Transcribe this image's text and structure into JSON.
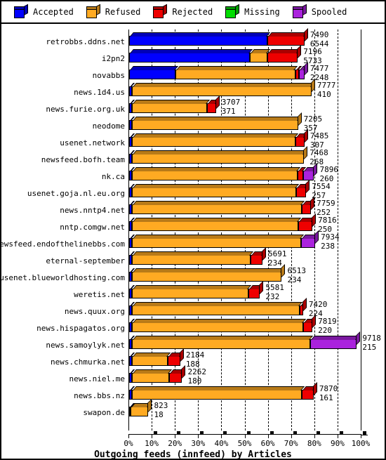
{
  "legend": {
    "items": [
      {
        "label": "Accepted",
        "color": "#0000ff",
        "icon": "cube-icon"
      },
      {
        "label": "Refused",
        "color": "#ffaa22",
        "icon": "cube-icon"
      },
      {
        "label": "Rejected",
        "color": "#ee0000",
        "icon": "cube-icon"
      },
      {
        "label": "Missing",
        "color": "#00dd00",
        "icon": "cube-icon"
      },
      {
        "label": "Spooled",
        "color": "#aa22dd",
        "icon": "cube-icon"
      }
    ]
  },
  "chart_data": {
    "type": "bar",
    "orientation": "horizontal",
    "stacked": true,
    "title": "Outgoing feeds (innfeed) by Articles",
    "xlabel": "Outgoing feeds (innfeed) by Articles",
    "ylabel": "",
    "xlim": [
      0,
      100
    ],
    "xtick_labels": [
      "0%",
      "10%",
      "20%",
      "30%",
      "40%",
      "50%",
      "60%",
      "70%",
      "80%",
      "90%",
      "100%"
    ],
    "xticks": [
      0,
      10,
      20,
      30,
      40,
      50,
      60,
      70,
      80,
      90,
      100
    ],
    "grid": "vertical-dashed",
    "legend_position": "top",
    "series_names": [
      "Accepted",
      "Refused",
      "Rejected",
      "Missing",
      "Spooled"
    ],
    "series_colors": [
      "#0000ff",
      "#ffaa22",
      "#ee0000",
      "#00dd00",
      "#aa22dd"
    ],
    "categories": [
      "retrobbs.ddns.net",
      "i2pn2",
      "novabbs",
      "news.1d4.us",
      "news.furie.org.uk",
      "neodome",
      "usenet.network",
      "newsfeed.bofh.team",
      "nk.ca",
      "usenet.goja.nl.eu.org",
      "news.nntp4.net",
      "nntp.comgw.net",
      "newsfeed.endofthelinebbs.com",
      "eternal-september",
      "usenet.blueworldhosting.com",
      "weretis.net",
      "news.quux.org",
      "news.hispagatos.org",
      "news.samoylyk.net",
      "news.chmurka.net",
      "news.niel.me",
      "news.bbs.nz",
      "swapon.de"
    ],
    "rows": [
      {
        "name": "retrobbs.ddns.net",
        "total": 7490,
        "secondary": 6544,
        "total_pct": 75.5,
        "segments": [
          {
            "s": "Accepted",
            "pct": 59.5
          },
          {
            "s": "Rejected",
            "pct": 16.0
          }
        ]
      },
      {
        "name": "i2pn2",
        "total": 7196,
        "secondary": 5733,
        "total_pct": 72.6,
        "segments": [
          {
            "s": "Accepted",
            "pct": 52.0
          },
          {
            "s": "Refused",
            "pct": 7.5
          },
          {
            "s": "Rejected",
            "pct": 13.1
          }
        ]
      },
      {
        "name": "novabbs",
        "total": 7477,
        "secondary": 2248,
        "total_pct": 75.5,
        "segments": [
          {
            "s": "Accepted",
            "pct": 20.0
          },
          {
            "s": "Refused",
            "pct": 51.5
          },
          {
            "s": "Rejected",
            "pct": 1.5
          },
          {
            "s": "Spooled",
            "pct": 2.5
          }
        ]
      },
      {
        "name": "news.1d4.us",
        "total": 7777,
        "secondary": 410,
        "total_pct": 78.5,
        "segments": [
          {
            "s": "Accepted",
            "pct": 1.2
          },
          {
            "s": "Refused",
            "pct": 77.3
          }
        ]
      },
      {
        "name": "news.furie.org.uk",
        "total": 3707,
        "secondary": 371,
        "total_pct": 37.4,
        "segments": [
          {
            "s": "Accepted",
            "pct": 1.2
          },
          {
            "s": "Refused",
            "pct": 32.2
          },
          {
            "s": "Rejected",
            "pct": 4.0
          }
        ]
      },
      {
        "name": "neodome",
        "total": 7205,
        "secondary": 357,
        "total_pct": 72.7,
        "segments": [
          {
            "s": "Accepted",
            "pct": 1.2
          },
          {
            "s": "Refused",
            "pct": 71.5
          }
        ]
      },
      {
        "name": "usenet.network",
        "total": 7485,
        "secondary": 307,
        "total_pct": 75.5,
        "segments": [
          {
            "s": "Accepted",
            "pct": 1.2
          },
          {
            "s": "Refused",
            "pct": 70.5
          },
          {
            "s": "Rejected",
            "pct": 3.8
          }
        ]
      },
      {
        "name": "newsfeed.bofh.team",
        "total": 7468,
        "secondary": 268,
        "total_pct": 75.3,
        "segments": [
          {
            "s": "Accepted",
            "pct": 1.2
          },
          {
            "s": "Refused",
            "pct": 74.1
          }
        ]
      },
      {
        "name": "nk.ca",
        "total": 7896,
        "secondary": 260,
        "total_pct": 79.6,
        "segments": [
          {
            "s": "Accepted",
            "pct": 1.2
          },
          {
            "s": "Refused",
            "pct": 71.4
          },
          {
            "s": "Rejected",
            "pct": 2.3
          },
          {
            "s": "Spooled",
            "pct": 4.7
          }
        ]
      },
      {
        "name": "usenet.goja.nl.eu.org",
        "total": 7554,
        "secondary": 257,
        "total_pct": 76.2,
        "segments": [
          {
            "s": "Accepted",
            "pct": 1.2
          },
          {
            "s": "Refused",
            "pct": 70.8
          },
          {
            "s": "Rejected",
            "pct": 4.2
          }
        ]
      },
      {
        "name": "news.nntp4.net",
        "total": 7759,
        "secondary": 252,
        "total_pct": 78.3,
        "segments": [
          {
            "s": "Accepted",
            "pct": 1.2
          },
          {
            "s": "Refused",
            "pct": 73.1
          },
          {
            "s": "Rejected",
            "pct": 4.0
          }
        ]
      },
      {
        "name": "nntp.comgw.net",
        "total": 7816,
        "secondary": 250,
        "total_pct": 78.9,
        "segments": [
          {
            "s": "Accepted",
            "pct": 1.2
          },
          {
            "s": "Refused",
            "pct": 71.7
          },
          {
            "s": "Rejected",
            "pct": 6.0
          }
        ]
      },
      {
        "name": "newsfeed.endofthelinebbs.com",
        "total": 7934,
        "secondary": 238,
        "total_pct": 80.1,
        "segments": [
          {
            "s": "Accepted",
            "pct": 1.2
          },
          {
            "s": "Refused",
            "pct": 72.9
          },
          {
            "s": "Spooled",
            "pct": 6.0
          }
        ]
      },
      {
        "name": "eternal-september",
        "total": 5691,
        "secondary": 234,
        "total_pct": 57.4,
        "segments": [
          {
            "s": "Accepted",
            "pct": 1.2
          },
          {
            "s": "Refused",
            "pct": 51.2
          },
          {
            "s": "Rejected",
            "pct": 5.0
          }
        ]
      },
      {
        "name": "usenet.blueworldhosting.com",
        "total": 6513,
        "secondary": 234,
        "total_pct": 65.7,
        "segments": [
          {
            "s": "Accepted",
            "pct": 1.2
          },
          {
            "s": "Refused",
            "pct": 64.5
          }
        ]
      },
      {
        "name": "weretis.net",
        "total": 5581,
        "secondary": 232,
        "total_pct": 56.3,
        "segments": [
          {
            "s": "Accepted",
            "pct": 1.2
          },
          {
            "s": "Refused",
            "pct": 50.1
          },
          {
            "s": "Rejected",
            "pct": 5.0
          }
        ]
      },
      {
        "name": "news.quux.org",
        "total": 7420,
        "secondary": 224,
        "total_pct": 74.9,
        "segments": [
          {
            "s": "Accepted",
            "pct": 1.2
          },
          {
            "s": "Refused",
            "pct": 72.2
          },
          {
            "s": "Rejected",
            "pct": 1.5
          }
        ]
      },
      {
        "name": "news.hispagatos.org",
        "total": 7819,
        "secondary": 220,
        "total_pct": 78.9,
        "segments": [
          {
            "s": "Accepted",
            "pct": 1.2
          },
          {
            "s": "Refused",
            "pct": 73.7
          },
          {
            "s": "Rejected",
            "pct": 4.0
          }
        ]
      },
      {
        "name": "news.samoylyk.net",
        "total": 9718,
        "secondary": 215,
        "total_pct": 98.0,
        "segments": [
          {
            "s": "Accepted",
            "pct": 1.2
          },
          {
            "s": "Refused",
            "pct": 76.8
          },
          {
            "s": "Spooled",
            "pct": 20.0
          }
        ]
      },
      {
        "name": "news.chmurka.net",
        "total": 2184,
        "secondary": 188,
        "total_pct": 22.0,
        "segments": [
          {
            "s": "Accepted",
            "pct": 1.2
          },
          {
            "s": "Refused",
            "pct": 15.3
          },
          {
            "s": "Rejected",
            "pct": 5.5
          }
        ]
      },
      {
        "name": "news.niel.me",
        "total": 2262,
        "secondary": 180,
        "total_pct": 22.8,
        "segments": [
          {
            "s": "Accepted",
            "pct": 1.2
          },
          {
            "s": "Refused",
            "pct": 16.1
          },
          {
            "s": "Rejected",
            "pct": 5.5
          }
        ]
      },
      {
        "name": "news.bbs.nz",
        "total": 7870,
        "secondary": 161,
        "total_pct": 79.4,
        "segments": [
          {
            "s": "Accepted",
            "pct": 1.2
          },
          {
            "s": "Refused",
            "pct": 73.2
          },
          {
            "s": "Rejected",
            "pct": 5.0
          }
        ]
      },
      {
        "name": "swapon.de",
        "total": 823,
        "secondary": 18,
        "total_pct": 8.3,
        "segments": [
          {
            "s": "Accepted",
            "pct": 0.6
          },
          {
            "s": "Refused",
            "pct": 7.7
          }
        ]
      }
    ]
  }
}
